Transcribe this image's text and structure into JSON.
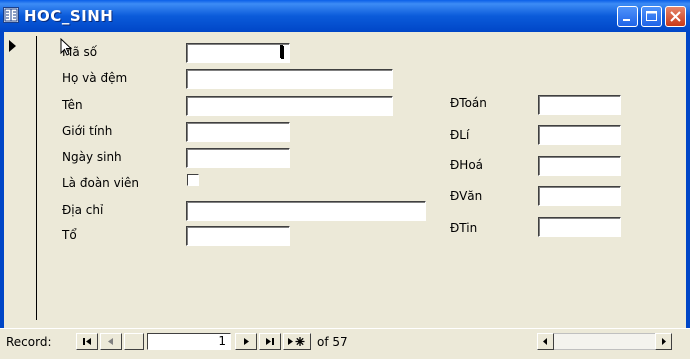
{
  "window": {
    "title": "HOC_SINH"
  },
  "form": {
    "left_labels": [
      "Mã số",
      "Họ và đệm",
      "Tên",
      "Giới tính",
      "Ngày sinh",
      "Là đoàn viên",
      "Địa chỉ",
      "Tổ"
    ],
    "right_labels": [
      "ĐToán",
      "ĐLí",
      "ĐHoá",
      "ĐVăn",
      "ĐTin"
    ],
    "doan_vien_checked": false
  },
  "navigation": {
    "record_label": "Record:",
    "current_record": "1",
    "of_text": "of 57"
  },
  "colors": {
    "titlebar": "#0A5FE8",
    "background": "#ECE9D8",
    "close_button": "#D8502E"
  }
}
